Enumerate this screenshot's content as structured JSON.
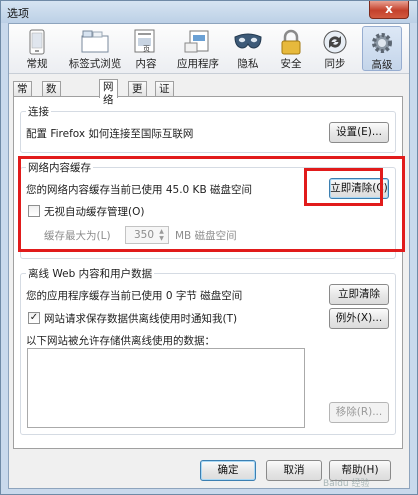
{
  "window": {
    "title": "选项",
    "close_glyph": "x"
  },
  "toolbar": {
    "items": [
      {
        "label": "常规",
        "icon": "general-icon"
      },
      {
        "label": "标签式浏览",
        "icon": "tabs-icon"
      },
      {
        "label": "内容",
        "icon": "content-icon"
      },
      {
        "label": "应用程序",
        "icon": "applications-icon"
      },
      {
        "label": "隐私",
        "icon": "privacy-mask-icon"
      },
      {
        "label": "安全",
        "icon": "security-lock-icon"
      },
      {
        "label": "同步",
        "icon": "sync-icon"
      },
      {
        "label": "高级",
        "icon": "advanced-gear-icon",
        "selected": true
      }
    ]
  },
  "subtabs": [
    "常规",
    "数据选择权",
    "网络",
    "更新",
    "证书"
  ],
  "active_subtab": "网络",
  "connection": {
    "title": "连接",
    "description": "配置 Firefox 如何连接至国际互联网",
    "settings_button": "设置(E)..."
  },
  "cache": {
    "title": "网络内容缓存",
    "usage_text": "您的网络内容缓存当前已使用 45.0 KB 磁盘空间",
    "clear_button": "立即清除(C)",
    "override_label": "无视自动缓存管理(O)",
    "override_checked": false,
    "limit_label": "缓存最大为(L)",
    "limit_value": "350",
    "limit_unit": "MB 磁盘空间"
  },
  "offline": {
    "title": "离线 Web 内容和用户数据",
    "usage_text": "您的应用程序缓存当前已使用 0 字节 磁盘空间",
    "clear_button": "立即清除(N)",
    "notify_label": "网站请求保存数据供离线使用时通知我(T)",
    "notify_checked": true,
    "exceptions_button": "例外(X)...",
    "list_label": "以下网站被允许存储供离线使用的数据：",
    "remove_button": "移除(R)..."
  },
  "footer": {
    "ok": "确定",
    "cancel": "取消",
    "help": "帮助(H)"
  },
  "watermark": "Baidu 经验",
  "accent": {
    "highlight_border": "#e11b1b",
    "selected_tab": "#c4d5ea"
  }
}
